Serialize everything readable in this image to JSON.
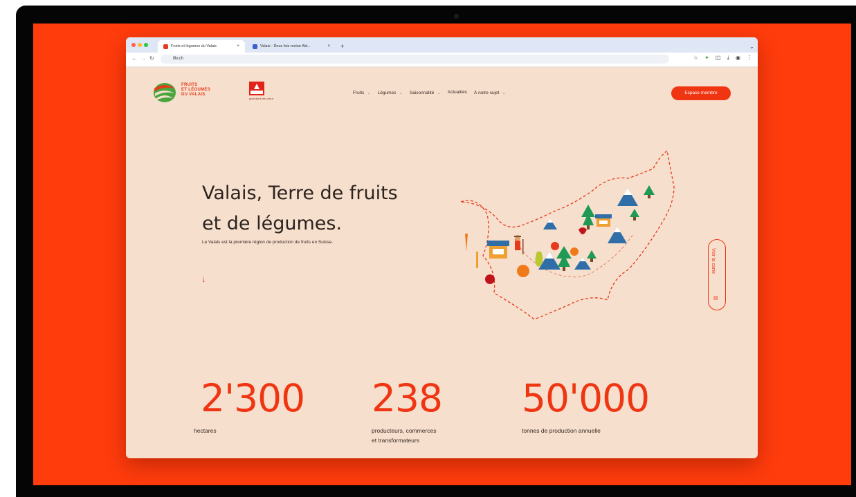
{
  "browser": {
    "tabs": [
      {
        "label": "Fruits et légumes du Valais"
      },
      {
        "label": "Valais - Deux fois meine Ald..."
      }
    ],
    "address": "iflv.ch"
  },
  "site": {
    "logo_text": [
      "FRUITS",
      "ET LÉGUMES",
      "DU VALAIS"
    ],
    "partner_logo_label": "Valais",
    "partner_logo_tagline": "goût dans les coeur",
    "nav": [
      {
        "label": "Fruits"
      },
      {
        "label": "Légumes"
      },
      {
        "label": "Saisonnalité"
      },
      {
        "label": "Actualités"
      },
      {
        "label": "À notre sujet"
      }
    ],
    "cta_label": "Espace membre"
  },
  "hero": {
    "title_line1": "Valais, Terre de fruits",
    "title_line2": "et de légumes.",
    "subtitle": "Le Valais est la première région de production de fruits en Suisse.",
    "map_button": "Voir la carte"
  },
  "stats": [
    {
      "value": "2'300",
      "label": "hectares"
    },
    {
      "value": "238",
      "label": "producteurs, commerces",
      "label2": "et transformateurs"
    },
    {
      "value": "50'000",
      "label": "tonnes de production annuelle"
    }
  ],
  "colors": {
    "accent": "#ef3512",
    "page_bg": "#f6dfcd",
    "screen_bg": "#ff3c0c"
  }
}
